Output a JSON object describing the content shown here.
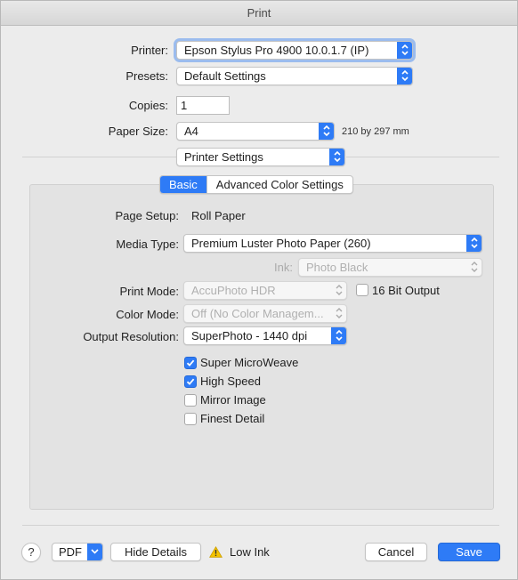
{
  "window": {
    "title": "Print"
  },
  "printer": {
    "label": "Printer:",
    "value": "Epson Stylus Pro 4900 10.0.1.7 (IP)"
  },
  "presets": {
    "label": "Presets:",
    "value": "Default Settings"
  },
  "copies": {
    "label": "Copies:",
    "value": "1"
  },
  "paper_size": {
    "label": "Paper Size:",
    "value": "A4",
    "note": "210 by 297 mm"
  },
  "section_popup": {
    "value": "Printer Settings"
  },
  "tabs": [
    {
      "label": "Basic",
      "active": true
    },
    {
      "label": "Advanced Color Settings",
      "active": false
    }
  ],
  "page_setup": {
    "label": "Page Setup:",
    "value": "Roll Paper"
  },
  "media_type": {
    "label": "Media Type:",
    "value": "Premium Luster Photo Paper (260)"
  },
  "ink": {
    "label": "Ink:",
    "value": "Photo Black",
    "enabled": false
  },
  "print_mode": {
    "label": "Print Mode:",
    "value": "AccuPhoto HDR",
    "enabled": false
  },
  "bit_output": {
    "label": "16 Bit Output",
    "checked": false
  },
  "color_mode": {
    "label": "Color Mode:",
    "value": "Off (No Color Managem...",
    "enabled": false
  },
  "output_resolution": {
    "label": "Output Resolution:",
    "value": "SuperPhoto - 1440 dpi"
  },
  "options": [
    {
      "label": "Super MicroWeave",
      "checked": true
    },
    {
      "label": "High Speed",
      "checked": true
    },
    {
      "label": "Mirror Image",
      "checked": false
    },
    {
      "label": "Finest Detail",
      "checked": false
    }
  ],
  "footer": {
    "help": "?",
    "pdf": "PDF",
    "hide_details": "Hide Details",
    "low_ink": "Low Ink",
    "cancel": "Cancel",
    "save": "Save"
  },
  "colors": {
    "accent": "#2e7bf6",
    "warning": "#f5c400"
  }
}
